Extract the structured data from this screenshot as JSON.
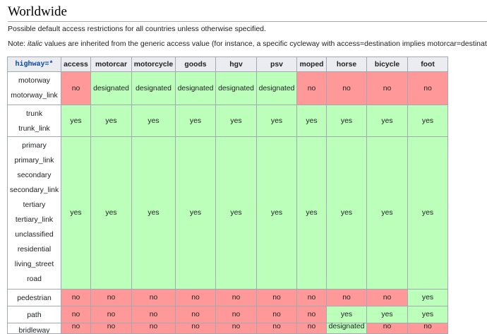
{
  "heading": "Worldwide",
  "intro": "Possible default access restrictions for all countries unless otherwise specified.",
  "note": {
    "prefix": "Note: ",
    "italic": "italic",
    "rest": " values are inherited from the generic access value (for instance, a specific cycleway with access=destination implies motorcar=destination, no"
  },
  "table": {
    "key_header": "highway=*",
    "columns": [
      "access",
      "motorcar",
      "motorcycle",
      "goods",
      "hgv",
      "psv",
      "moped",
      "horse",
      "bicycle",
      "foot"
    ],
    "rows": [
      {
        "keys": [
          "motorway",
          "motorway_link"
        ],
        "values": [
          "no",
          "designated",
          "designated",
          "designated",
          "designated",
          "designated",
          "no",
          "no",
          "no",
          "no"
        ]
      },
      {
        "keys": [
          "trunk",
          "trunk_link"
        ],
        "values": [
          "yes",
          "yes",
          "yes",
          "yes",
          "yes",
          "yes",
          "yes",
          "yes",
          "yes",
          "yes"
        ]
      },
      {
        "keys": [
          "primary",
          "primary_link",
          "secondary",
          "secondary_link",
          "tertiary",
          "tertiary_link",
          "unclassified",
          "residential",
          "living_street",
          "road"
        ],
        "values": [
          "yes",
          "yes",
          "yes",
          "yes",
          "yes",
          "yes",
          "yes",
          "yes",
          "yes",
          "yes"
        ]
      },
      {
        "keys": [
          "pedestrian"
        ],
        "values": [
          "no",
          "no",
          "no",
          "no",
          "no",
          "no",
          "no",
          "no",
          "no",
          "yes"
        ]
      },
      {
        "keys": [
          "path"
        ],
        "values": [
          "no",
          "no",
          "no",
          "no",
          "no",
          "no",
          "no",
          "yes",
          "yes",
          "yes"
        ]
      },
      {
        "keys": [
          "bridleway"
        ],
        "values": [
          "no",
          "no",
          "no",
          "no",
          "no",
          "no",
          "no",
          "designated",
          "no",
          "no"
        ]
      }
    ]
  },
  "colors": {
    "yes": "#bbffbb",
    "no": "#ff9999",
    "designated": "#bbffbb",
    "header": "#eaecf0",
    "border": "#a2a9b1"
  }
}
